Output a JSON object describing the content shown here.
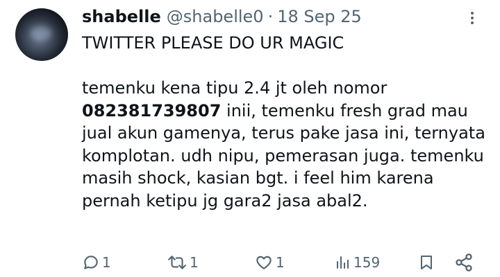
{
  "tweet": {
    "display_name": "shabelle",
    "handle": "@shabelle0",
    "separator": "·",
    "date": "18 Sep 25",
    "headline": "TWITTER PLEASE DO UR MAGIC",
    "text_before_phone": "temenku kena tipu 2.4 jt oleh nomor",
    "phone_number": "082381739807",
    "text_after_phone": " inii, temenku fresh grad mau jual akun gamenya, terus pake jasa ini, ternyata komplotan. udh nipu, pemerasan juga. temenku masih shock, kasian bgt. i feel him karena pernah ketipu jg gara2 jasa abal2."
  },
  "actions": {
    "replies": "1",
    "reposts": "1",
    "likes": "1",
    "views": "159"
  },
  "icons": {
    "more": "more-vertical-icon",
    "reply": "reply-icon",
    "repost": "repost-icon",
    "like": "heart-icon",
    "views": "analytics-icon",
    "bookmark": "bookmark-icon",
    "share": "share-icon"
  },
  "colors": {
    "text": "#0f1419",
    "secondary": "#536471"
  }
}
